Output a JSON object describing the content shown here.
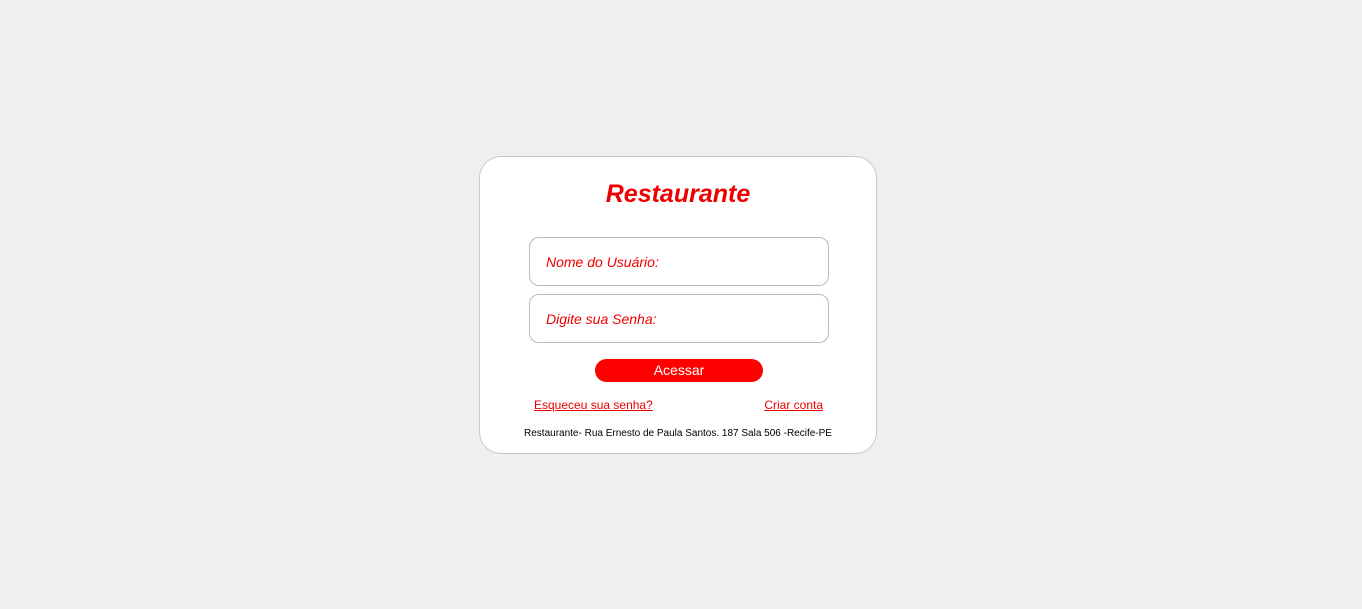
{
  "login": {
    "title": "Restaurante",
    "username_placeholder": "Nome do Usuário:",
    "password_placeholder": "Digite sua Senha:",
    "submit_label": "Acessar",
    "forgot_password_link": "Esqueceu sua senha?",
    "create_account_link": "Criar conta",
    "footer_address": "Restaurante- Rua Ernesto de Paula Santos. 187 Sala 506 -Recife-PE"
  },
  "colors": {
    "accent": "#ff0000",
    "page_background": "#efefef",
    "card_background": "#ffffff",
    "field_border": "#b9b9b9"
  }
}
